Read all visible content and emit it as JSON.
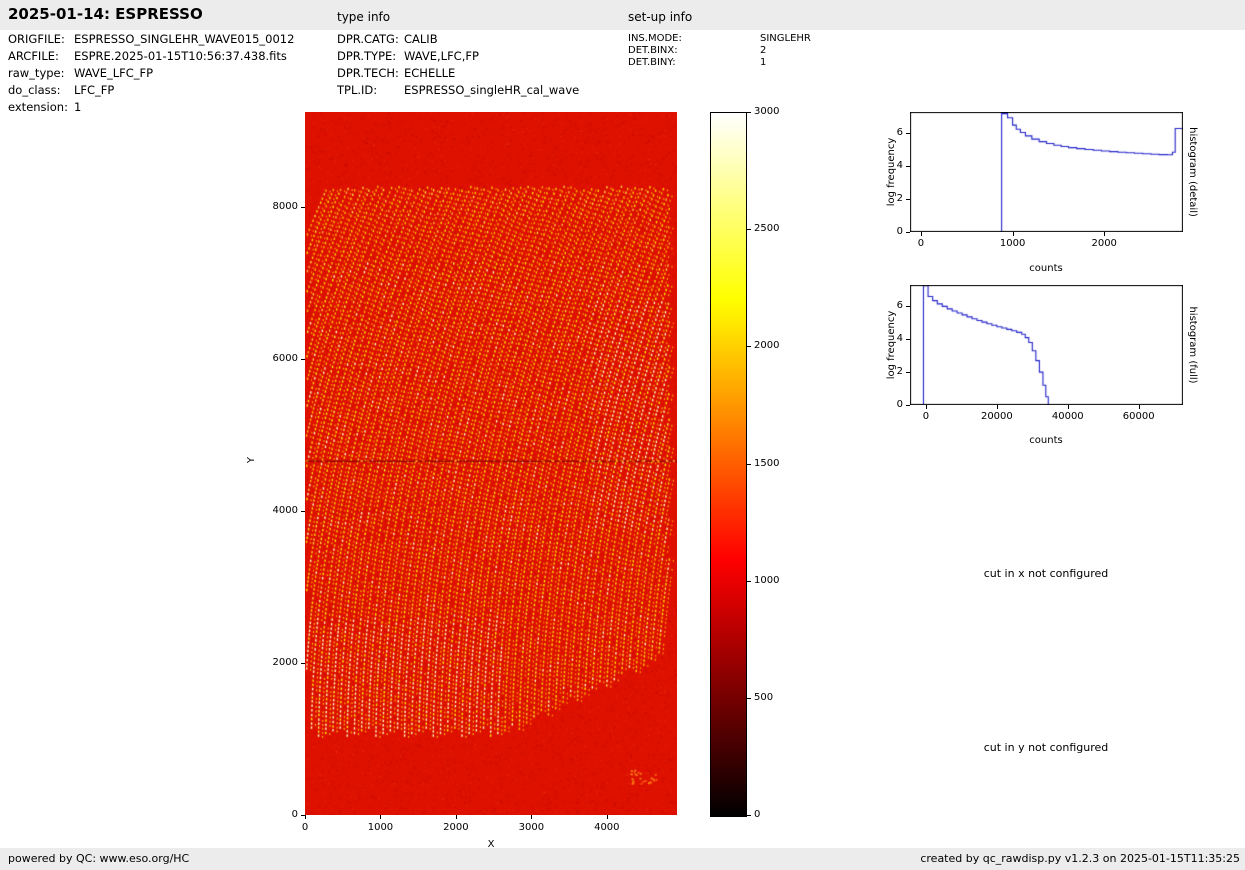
{
  "header": {
    "title": "2025-01-14: ESPRESSO",
    "type_info_label": "type info",
    "setup_info_label": "set-up info"
  },
  "file_info": {
    "rows": [
      {
        "label": "ORIGFILE:",
        "value": "ESPRESSO_SINGLEHR_WAVE015_0012"
      },
      {
        "label": "ARCFILE:",
        "value": "ESPRE.2025-01-15T10:56:37.438.fits"
      },
      {
        "label": "raw_type:",
        "value": "WAVE_LFC_FP"
      },
      {
        "label": "do_class:",
        "value": "LFC_FP"
      },
      {
        "label": "extension:",
        "value": "1"
      }
    ]
  },
  "type_info": {
    "rows": [
      {
        "label": "DPR.CATG:",
        "value": "CALIB"
      },
      {
        "label": "DPR.TYPE:",
        "value": "WAVE,LFC,FP"
      },
      {
        "label": "DPR.TECH:",
        "value": "ECHELLE"
      },
      {
        "label": "TPL.ID:",
        "value": "ESPRESSO_singleHR_cal_wave"
      }
    ]
  },
  "setup_info": {
    "rows": [
      {
        "label": "INS.MODE:",
        "value": "SINGLEHR"
      },
      {
        "label": "DET.BINX:",
        "value": "2"
      },
      {
        "label": "DET.BINY:",
        "value": "1"
      }
    ]
  },
  "messages": {
    "cut_x": "cut in x not configured",
    "cut_y": "cut in y not configured"
  },
  "footer": {
    "left": "powered by QC: www.eso.org/HC",
    "right": "created by qc_rawdisp.py v1.2.3 on 2025-01-15T11:35:25"
  },
  "chart_data": [
    {
      "type": "heatmap",
      "name": "raw-frame",
      "description": "Raw ESPRESSO LFC/FP wavelength calibration frame displayed with hot colormap: dotted bright echelle-order arcs on saturated red background, dark horizontal detector gap line near y=4660, bright pile-up at right edge",
      "xlabel": "X",
      "ylabel": "Y",
      "xlim": [
        0,
        4930
      ],
      "ylim": [
        0,
        9245
      ],
      "x_ticks": [
        0,
        1000,
        2000,
        3000,
        4000
      ],
      "y_ticks": [
        0,
        2000,
        4000,
        6000,
        8000
      ],
      "background_color": "#de1000",
      "colorbar": {
        "colormap": "hot",
        "vmin": 0,
        "vmax": 3000,
        "ticks": [
          0,
          500,
          1000,
          1500,
          2000,
          2500,
          3000
        ]
      }
    },
    {
      "type": "histogram",
      "title": "histogram (detail)",
      "xlabel": "counts",
      "ylabel": "log frequency",
      "xlim": [
        -120,
        2860
      ],
      "ylim": [
        0,
        7.3
      ],
      "x_ticks": [
        0,
        1000,
        2000
      ],
      "y_ticks": [
        0,
        2,
        4,
        6
      ],
      "line_color": "#2222cc",
      "points": [
        [
          880,
          7.2
        ],
        [
          945,
          6.95
        ],
        [
          1000,
          6.5
        ],
        [
          1040,
          6.25
        ],
        [
          1085,
          6.05
        ],
        [
          1140,
          5.85
        ],
        [
          1210,
          5.65
        ],
        [
          1290,
          5.5
        ],
        [
          1370,
          5.38
        ],
        [
          1450,
          5.28
        ],
        [
          1530,
          5.2
        ],
        [
          1610,
          5.13
        ],
        [
          1700,
          5.07
        ],
        [
          1790,
          5.02
        ],
        [
          1880,
          4.97
        ],
        [
          1970,
          4.93
        ],
        [
          2060,
          4.89
        ],
        [
          2150,
          4.85
        ],
        [
          2240,
          4.82
        ],
        [
          2330,
          4.79
        ],
        [
          2420,
          4.76
        ],
        [
          2510,
          4.73
        ],
        [
          2600,
          4.71
        ],
        [
          2690,
          4.7
        ],
        [
          2745,
          4.85
        ],
        [
          2775,
          6.3
        ]
      ]
    },
    {
      "type": "histogram",
      "title": "histogram (full)",
      "xlabel": "counts",
      "ylabel": "log frequency",
      "xlim": [
        -4500,
        72500
      ],
      "ylim": [
        0,
        7.3
      ],
      "x_ticks": [
        0,
        20000,
        40000,
        60000
      ],
      "y_ticks": [
        0,
        2,
        4,
        6
      ],
      "line_color": "#2222cc",
      "points": [
        [
          -700,
          7.25
        ],
        [
          600,
          6.6
        ],
        [
          1900,
          6.35
        ],
        [
          3200,
          6.15
        ],
        [
          4600,
          6.0
        ],
        [
          6000,
          5.85
        ],
        [
          7400,
          5.72
        ],
        [
          8800,
          5.6
        ],
        [
          10200,
          5.48
        ],
        [
          11600,
          5.36
        ],
        [
          13000,
          5.25
        ],
        [
          14400,
          5.14
        ],
        [
          15800,
          5.04
        ],
        [
          17200,
          4.94
        ],
        [
          18600,
          4.85
        ],
        [
          20000,
          4.76
        ],
        [
          21400,
          4.68
        ],
        [
          22800,
          4.6
        ],
        [
          24200,
          4.52
        ],
        [
          25600,
          4.42
        ],
        [
          27000,
          4.3
        ],
        [
          28000,
          4.1
        ],
        [
          29000,
          3.8
        ],
        [
          30000,
          3.3
        ],
        [
          31000,
          2.7
        ],
        [
          32000,
          2.0
        ],
        [
          33000,
          1.2
        ],
        [
          33800,
          0.5
        ],
        [
          34500,
          0
        ]
      ]
    }
  ]
}
